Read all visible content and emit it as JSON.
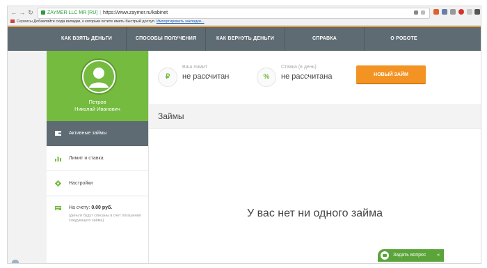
{
  "browser": {
    "secure_label": "ZAYMER LLC MR [RU]",
    "url": "https://www.zaymer.ru/kabinet",
    "bookmarks_label": "Сервисы",
    "bookmarks_hint": "Добавляйте сюда вкладки, к которым хотите иметь быстрый доступ.",
    "bookmarks_link": "Импортировать закладки..."
  },
  "topnav": {
    "items": [
      {
        "label": "КАК ВЗЯТЬ ДЕНЬГИ"
      },
      {
        "label": "СПОСОБЫ ПОЛУЧЕНИЯ"
      },
      {
        "label": "КАК ВЕРНУТЬ ДЕНЬГИ"
      },
      {
        "label": "СПРАВКА"
      },
      {
        "label": "О РОБОТЕ"
      }
    ]
  },
  "profile": {
    "last_name": "Петров",
    "first_middle": "Николай Иванович"
  },
  "sidebar": {
    "items": [
      {
        "label": "Активные займы",
        "icon": "wallet-icon"
      },
      {
        "label": "Лимит и ставка",
        "icon": "bar-chart-icon"
      },
      {
        "label": "Настройки",
        "icon": "gear-icon"
      }
    ],
    "balance_label": "На счету:",
    "balance_value": "0.00 руб.",
    "balance_note": "(деньги будут списаны в счет погашения следующего займа)"
  },
  "stats": {
    "limit": {
      "symbol": "₽",
      "label": "Ваш лимит",
      "value": "не рассчитан"
    },
    "rate": {
      "symbol": "%",
      "label": "Ставка (в день)",
      "value": "не рассчитана"
    }
  },
  "new_loan_button": "НОВЫЙ ЗАЙМ",
  "loans_section": {
    "title": "Займы",
    "empty_message": "У вас нет ни одного займа"
  },
  "chat": {
    "label": "Задать вопрос",
    "arrow": "«"
  },
  "colors": {
    "green": "#74bb3f",
    "nav_gray": "#5e6b72",
    "orange": "#f39323"
  }
}
